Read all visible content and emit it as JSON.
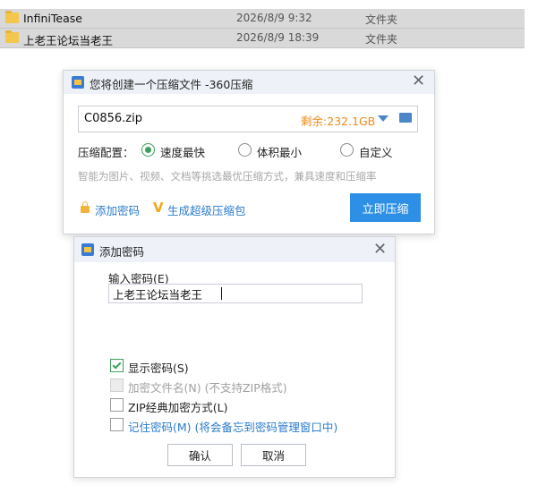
{
  "files": [
    {
      "name": "InfiniTease",
      "date": "2026/8/9 9:32",
      "type": "文件夹"
    },
    {
      "name": "上老王论坛当老王",
      "date": "2026/8/9 18:39",
      "type": "文件夹"
    }
  ],
  "compress_dialog": {
    "title": "您将创建一个压缩文件 -360压缩",
    "filename": "C0856.zip",
    "free_space": "剩余:232.1GB",
    "config_label": "压缩配置：",
    "options": [
      "速度最快",
      "体积最小",
      "自定义"
    ],
    "selected_option": "速度最快",
    "hint": "智能为图片、视频、文档等挑选最优压缩方式，兼具速度和压缩率",
    "add_password": "添加密码",
    "super_package": "生成超级压缩包",
    "compress_button": "立即压缩"
  },
  "password_dialog": {
    "title": "添加密码",
    "input_label": "输入密码(E)",
    "password_value": "上老王论坛当老王",
    "show_password": "显示密码(S)",
    "encrypt_filename": "加密文件名(N) (不支持ZIP格式)",
    "zip_classic": "ZIP经典加密方式(L)",
    "remember_password": "记住密码(M) (将会备忘到密码管理窗口中)",
    "ok": "确认",
    "cancel": "取消"
  },
  "colors": {
    "accent": "#2d8fe6",
    "free_space": "#ee8a1a",
    "check": "#3aa05b",
    "link": "#2a7ccb"
  }
}
